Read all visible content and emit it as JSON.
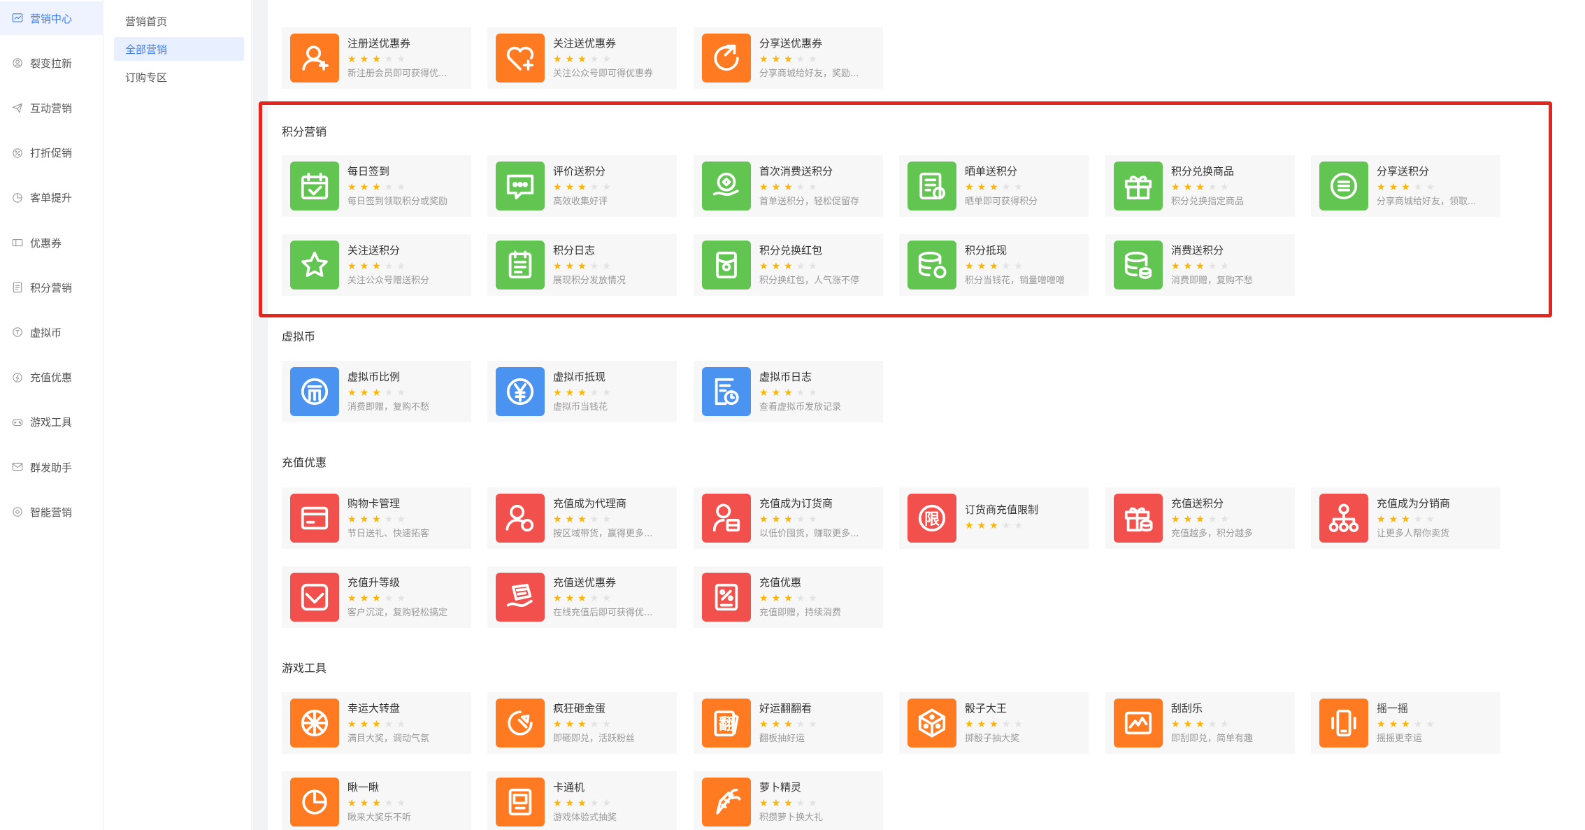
{
  "sidebar": {
    "items": [
      {
        "label": "营销中心",
        "icon": "dashboard-icon",
        "active": true
      },
      {
        "label": "裂变拉新",
        "icon": "fission-icon"
      },
      {
        "label": "互动营销",
        "icon": "paper-plane-icon"
      },
      {
        "label": "打折促销",
        "icon": "discount-icon"
      },
      {
        "label": "客单提升",
        "icon": "chart-icon"
      },
      {
        "label": "优惠券",
        "icon": "coupon-icon"
      },
      {
        "label": "积分营销",
        "icon": "points-icon"
      },
      {
        "label": "虚拟币",
        "icon": "coin-icon"
      },
      {
        "label": "充值优惠",
        "icon": "recharge-icon"
      },
      {
        "label": "游戏工具",
        "icon": "gamepad-icon"
      },
      {
        "label": "群发助手",
        "icon": "message-icon"
      },
      {
        "label": "智能营销",
        "icon": "smart-icon"
      }
    ]
  },
  "subnav": {
    "items": [
      {
        "label": "营销首页"
      },
      {
        "label": "全部营销",
        "active": true
      },
      {
        "label": "订购专区"
      }
    ]
  },
  "sections": {
    "coupon_partial": {
      "cards": [
        {
          "title": "注册送优惠券",
          "desc": "新注册会员即可获得优...",
          "icon": "user-add-icon",
          "color": "orange",
          "rating": 3
        },
        {
          "title": "关注送优惠券",
          "desc": "关注公众号即可得优惠券",
          "icon": "heart-plus-icon",
          "color": "orange",
          "rating": 3
        },
        {
          "title": "分享送优惠券",
          "desc": "分享商城给好友，奖励...",
          "icon": "share-icon",
          "color": "orange",
          "rating": 3
        }
      ]
    },
    "points": {
      "title": "积分营销",
      "cards": [
        {
          "title": "每日签到",
          "desc": "每日签到领取积分或奖励",
          "icon": "calendar-check-icon",
          "color": "green",
          "rating": 3
        },
        {
          "title": "评价送积分",
          "desc": "高效收集好评",
          "icon": "comment-icon",
          "color": "green",
          "rating": 3
        },
        {
          "title": "首次消费送积分",
          "desc": "首单送积分，轻松促留存",
          "icon": "hand-coin-icon",
          "color": "green",
          "rating": 3
        },
        {
          "title": "晒单送积分",
          "desc": "晒单即可获得积分",
          "icon": "order-share-icon",
          "color": "green",
          "rating": 3
        },
        {
          "title": "积分兑换商品",
          "desc": "积分兑换指定商品",
          "icon": "gift-icon",
          "color": "green",
          "rating": 3
        },
        {
          "title": "分享送积分",
          "desc": "分享商城给好友，领取...",
          "icon": "coin-stack-icon",
          "color": "green",
          "rating": 3
        },
        {
          "title": "关注送积分",
          "desc": "关注公众号赠送积分",
          "icon": "star-icon",
          "color": "green",
          "rating": 3
        },
        {
          "title": "积分日志",
          "desc": "展现积分发放情况",
          "icon": "log-icon",
          "color": "green",
          "rating": 3
        },
        {
          "title": "积分兑换红包",
          "desc": "积分换红包，人气涨不停",
          "icon": "red-packet-icon",
          "color": "green",
          "rating": 3
        },
        {
          "title": "积分抵现",
          "desc": "积分当钱花，销量噌噌噌",
          "icon": "database-yuan-icon",
          "color": "green",
          "rating": 3
        },
        {
          "title": "消费送积分",
          "desc": "消费即赠，复购不愁",
          "icon": "database-coin-icon",
          "color": "green",
          "rating": 3
        }
      ]
    },
    "virtual": {
      "title": "虚拟币",
      "cards": [
        {
          "title": "虚拟币比例",
          "desc": "消费即赠，复购不愁",
          "icon": "coin-ratio-icon",
          "color": "blue",
          "rating": 3
        },
        {
          "title": "虚拟币抵现",
          "desc": "虚拟币当钱花",
          "icon": "yuan-circle-icon",
          "color": "blue",
          "rating": 3
        },
        {
          "title": "虚拟币日志",
          "desc": "查看虚拟币发放记录",
          "icon": "record-icon",
          "color": "blue",
          "rating": 3
        }
      ]
    },
    "recharge": {
      "title": "充值优惠",
      "cards": [
        {
          "title": "购物卡管理",
          "desc": "节日送礼、快速拓客",
          "icon": "card-icon",
          "color": "red",
          "rating": 3
        },
        {
          "title": "充值成为代理商",
          "desc": "按区域带货，赢得更多...",
          "icon": "agent-icon",
          "color": "red",
          "rating": 3
        },
        {
          "title": "充值成为订货商",
          "desc": "以低价囤货，赚取更多...",
          "icon": "dealer-icon",
          "color": "red",
          "rating": 3
        },
        {
          "title": "订货商充值限制",
          "desc": "",
          "icon": "limit-icon",
          "color": "red",
          "rating": 3,
          "icon_text": "限"
        },
        {
          "title": "充值送积分",
          "desc": "充值越多，积分越多",
          "icon": "gift-coin-icon",
          "color": "red",
          "rating": 3
        },
        {
          "title": "充值成为分销商",
          "desc": "让更多人帮你卖货",
          "icon": "org-tree-icon",
          "color": "red",
          "rating": 3
        },
        {
          "title": "充值升等级",
          "desc": "客户沉淀，复购轻松搞定",
          "icon": "diamond-icon",
          "color": "red",
          "rating": 3
        },
        {
          "title": "充值送优惠券",
          "desc": "在线充值后即可获得优...",
          "icon": "coupon-hand-icon",
          "color": "red",
          "rating": 3
        },
        {
          "title": "充值优惠",
          "desc": "充值即赠，持续消费",
          "icon": "percent-doc-icon",
          "color": "red",
          "rating": 3
        }
      ]
    },
    "games": {
      "title": "游戏工具",
      "cards": [
        {
          "title": "幸运大转盘",
          "desc": "满目大奖，调动气氛",
          "icon": "wheel-icon",
          "color": "orange",
          "rating": 3
        },
        {
          "title": "疯狂砸金蛋",
          "desc": "即砸即兑，活跃粉丝",
          "icon": "hammer-icon",
          "color": "orange",
          "rating": 3
        },
        {
          "title": "好运翻翻看",
          "desc": "翻板抽好运",
          "icon": "flip-card-icon",
          "color": "orange",
          "rating": 3,
          "icon_text": "翻"
        },
        {
          "title": "骰子大王",
          "desc": "掷骰子抽大奖",
          "icon": "dice-icon",
          "color": "orange",
          "rating": 3
        },
        {
          "title": "刮刮乐",
          "desc": "即刮即兑，简单有趣",
          "icon": "scratch-icon",
          "color": "orange",
          "rating": 3
        },
        {
          "title": "摇一摇",
          "desc": "摇摇更幸运",
          "icon": "shake-phone-icon",
          "color": "orange",
          "rating": 3
        },
        {
          "title": "瞅一瞅",
          "desc": "瞅来大奖乐不听",
          "icon": "pie-icon",
          "color": "orange",
          "rating": 3
        },
        {
          "title": "卡通机",
          "desc": "游戏体验式抽奖",
          "icon": "machine-icon",
          "color": "orange",
          "rating": 3
        },
        {
          "title": "萝卜精灵",
          "desc": "积攒萝卜换大礼",
          "icon": "carrot-icon",
          "color": "orange",
          "rating": 3
        }
      ]
    }
  },
  "colors": {
    "orange": "#ff7a21",
    "green": "#62c552",
    "blue": "#4a93f0",
    "red": "#f2504c",
    "accent": "#3d7cf4",
    "highlight": "#e8231b"
  }
}
